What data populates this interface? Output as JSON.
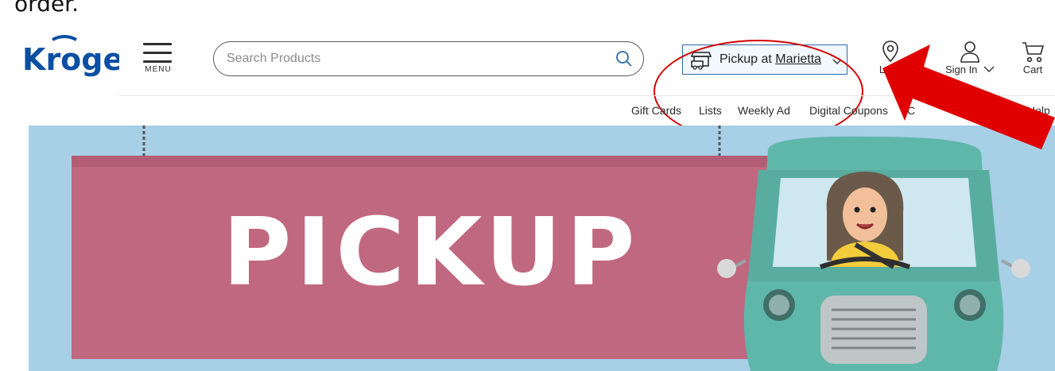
{
  "caption": "order.",
  "header": {
    "logo_text": "Kroger",
    "menu_label": "MENU",
    "search_placeholder": "Search Products",
    "pickup": {
      "prefix": "Pickup at ",
      "store": "Marietta"
    },
    "locations_label": "Loca",
    "sign_in_label": "Sign In",
    "cart_label": "Cart"
  },
  "subnav": {
    "gift_cards": "Gift Cards",
    "lists": "Lists",
    "weekly_ad": "Weekly Ad",
    "digital_coupons": "Digital Coupons",
    "clipped_c": "C",
    "help": "Help"
  },
  "hero": {
    "banner_text": "PICKUP"
  },
  "colors": {
    "brand_blue": "#0b4fa3",
    "hero_bg": "#a7cfe6",
    "banner_pink": "#c0687f",
    "annotation_red": "#e00000",
    "car_teal": "#5fb7a9"
  },
  "icons": [
    "menu-icon",
    "search-icon",
    "pickup-store-icon",
    "chevron-down-icon",
    "location-pin-icon",
    "user-icon",
    "cart-icon"
  ]
}
